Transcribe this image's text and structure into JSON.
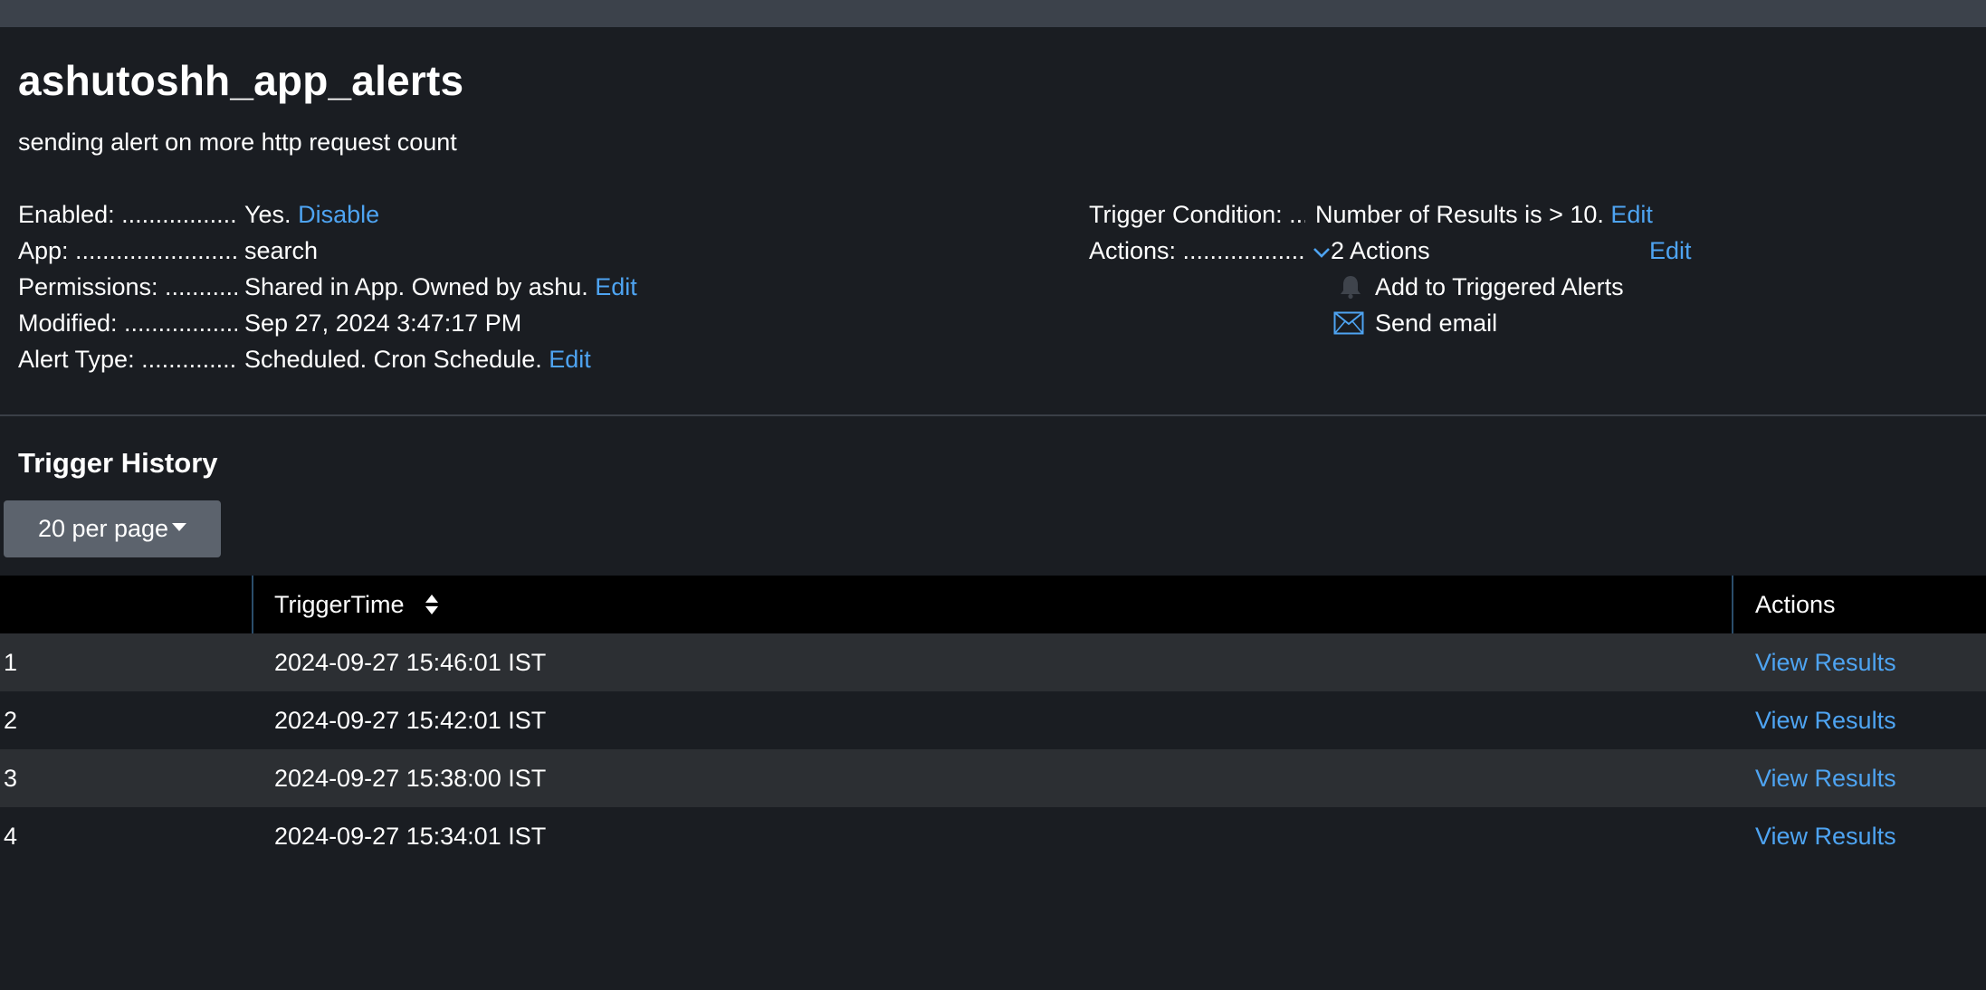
{
  "alert": {
    "title": "ashutoshh_app_alerts",
    "description": "sending alert on more http request count"
  },
  "details": {
    "enabled": {
      "label": "Enabled: ..........................................",
      "value": "Yes.",
      "action": "Disable"
    },
    "app": {
      "label": "App: ..........................................",
      "value": "search"
    },
    "permissions": {
      "label": "Permissions: ..........................................",
      "value": "Shared in App. Owned by ashu.",
      "action": "Edit"
    },
    "modified": {
      "label": "Modified: ..........................................",
      "value": "Sep 27, 2024 3:47:17 PM"
    },
    "alert_type": {
      "label": "Alert Type: ..........................................",
      "value": "Scheduled. Cron Schedule.",
      "action": "Edit"
    }
  },
  "trigger": {
    "condition": {
      "label": "Trigger Condition: ..........................................",
      "value": "Number of Results is > 10.",
      "action": "Edit"
    },
    "actions": {
      "label": "Actions: ..........................................",
      "summary": "2 Actions",
      "edit": "Edit",
      "items": [
        {
          "label": "Add to Triggered Alerts",
          "icon": "bell-icon"
        },
        {
          "label": "Send email",
          "icon": "envelope-icon"
        }
      ]
    }
  },
  "history": {
    "title": "Trigger History",
    "per_page": "20 per page",
    "columns": {
      "trigger_time": "TriggerTime",
      "actions": "Actions"
    },
    "rows": [
      {
        "index": "1",
        "time": "2024-09-27 15:46:01 IST",
        "action": "View Results"
      },
      {
        "index": "2",
        "time": "2024-09-27 15:42:01 IST",
        "action": "View Results"
      },
      {
        "index": "3",
        "time": "2024-09-27 15:38:00 IST",
        "action": "View Results"
      },
      {
        "index": "4",
        "time": "2024-09-27 15:34:01 IST",
        "action": "View Results"
      }
    ]
  },
  "colors": {
    "background": "#1a1d22",
    "link": "#4ea4f2",
    "header_bg": "#000000",
    "row_alt": "#2c2f33",
    "button_bg": "#5c636d"
  }
}
